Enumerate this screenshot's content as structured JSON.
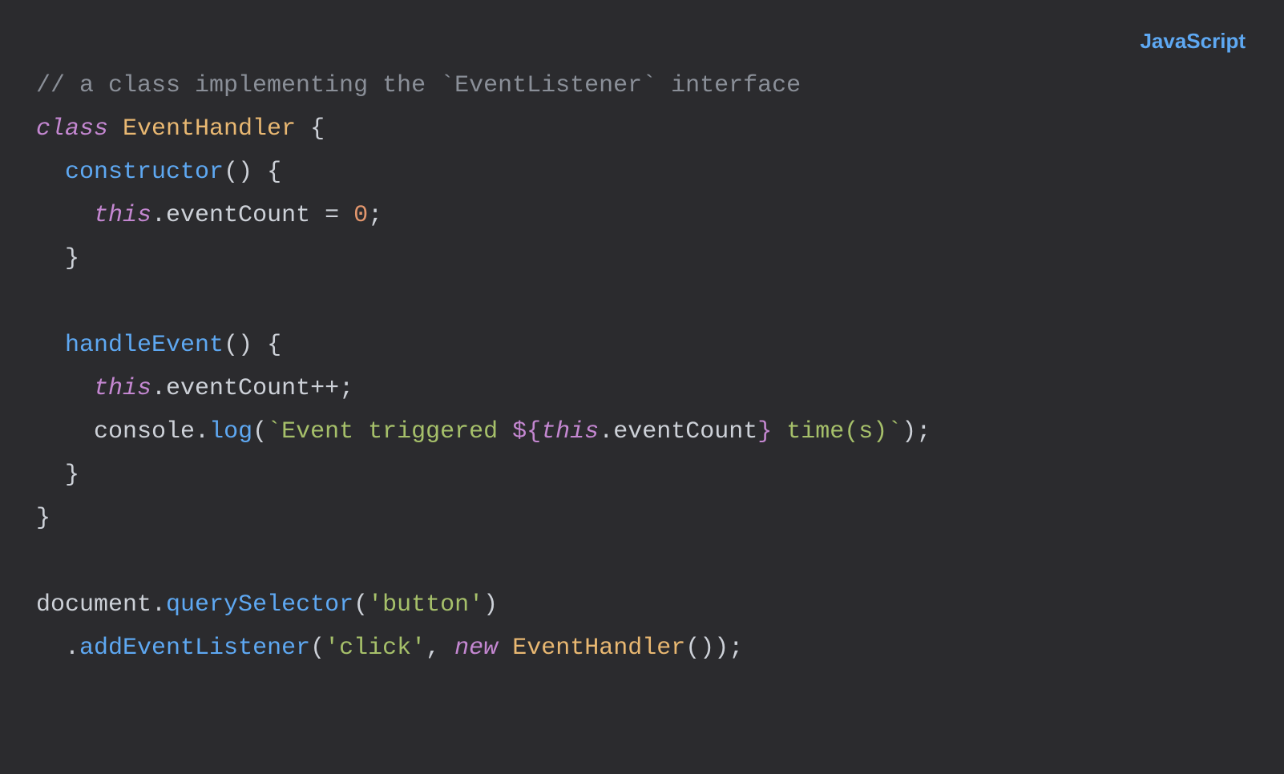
{
  "lang_label": "JavaScript",
  "code": {
    "l1": {
      "comment": "// a class implementing the `EventListener` interface"
    },
    "l2": {
      "class_kw": "class",
      "classname": "EventHandler",
      "brace": " {"
    },
    "l3": {
      "ctor": "constructor",
      "parens": "()",
      "brace": " {"
    },
    "l4": {
      "this_kw": "this",
      "dot": ".",
      "prop": "eventCount",
      "eq": " = ",
      "num": "0",
      "semi": ";"
    },
    "l5": {
      "brace": "}"
    },
    "l6": {
      "blank": ""
    },
    "l7": {
      "fn": "handleEvent",
      "parens": "()",
      "brace": " {"
    },
    "l8": {
      "this_kw": "this",
      "dot": ".",
      "prop": "eventCount",
      "op": "++",
      "semi": ";"
    },
    "l9": {
      "console": "console",
      "dot": ".",
      "log": "log",
      "open": "(",
      "tick1": "`",
      "str1": "Event triggered ",
      "interp_open": "${",
      "this_kw": "this",
      "dot2": ".",
      "prop": "eventCount",
      "interp_close": "}",
      "str2": " time(s)",
      "tick2": "`",
      "close": ")",
      "semi": ";"
    },
    "l10": {
      "brace": "}"
    },
    "l11": {
      "brace": "}"
    },
    "l12": {
      "blank": ""
    },
    "l13": {
      "doc": "document",
      "dot": ".",
      "qs": "querySelector",
      "open": "(",
      "q1": "'",
      "str": "button",
      "q2": "'",
      "close": ")"
    },
    "l14": {
      "dot": ".",
      "ael": "addEventListener",
      "open": "(",
      "q1": "'",
      "str": "click",
      "q2": "'",
      "comma": ", ",
      "new_kw": "new",
      "sp": " ",
      "classname": "EventHandler",
      "parens": "()",
      "close": ")",
      "semi": ";"
    }
  }
}
